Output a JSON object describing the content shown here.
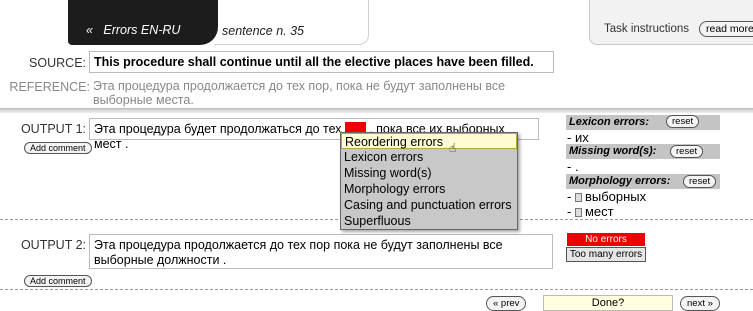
{
  "header": {
    "back_glyph": "«",
    "title": "Errors EN-RU",
    "sentence": "sentence n. 35",
    "task_instructions": "Task instructions",
    "read_more": "read more"
  },
  "source": {
    "label": "SOURCE:",
    "text": "This procedure shall continue until all the elective places have been filled."
  },
  "reference": {
    "label": "REFERENCE:",
    "text": "Эта процедура продолжается до тех пор, пока не будут заполнены все выборные места."
  },
  "output1": {
    "label": "OUTPUT 1:",
    "text_before": "Эта процедура будет продолжаться до тех",
    "highlight": "пор",
    "text_after": ", пока все их выборных мест .",
    "add_comment": "Add comment"
  },
  "menu": {
    "items": [
      "Reordering errors",
      "Lexicon errors",
      "Missing word(s)",
      "Morphology errors",
      "Casing and punctuation errors",
      "Superfluous"
    ],
    "selected_index": 0
  },
  "panel": {
    "lexicon_title": "Lexicon errors:",
    "reset": "reset",
    "lexicon_item": "- их",
    "missing_title": "Missing word(s):",
    "missing_item": "- .",
    "morph_title": "Morphology errors:",
    "morph_items": [
      "- ",
      "- "
    ],
    "morph_words": [
      "выборных",
      "мест"
    ]
  },
  "output2": {
    "label": "OUTPUT 2:",
    "text": "Эта процедура продолжается до тех пор пока не будут заполнены все выборные должности .",
    "add_comment": "Add comment",
    "no_errors": "No errors",
    "too_many": "Too many errors"
  },
  "footer": {
    "prev": "« prev",
    "done": "Done?",
    "next": "next »"
  },
  "colors": {
    "highlight": "#e00000",
    "menu_bg": "#c8c8c8",
    "selected_bg": "#fffbd5",
    "dark_tab": "#1c1c1c"
  }
}
